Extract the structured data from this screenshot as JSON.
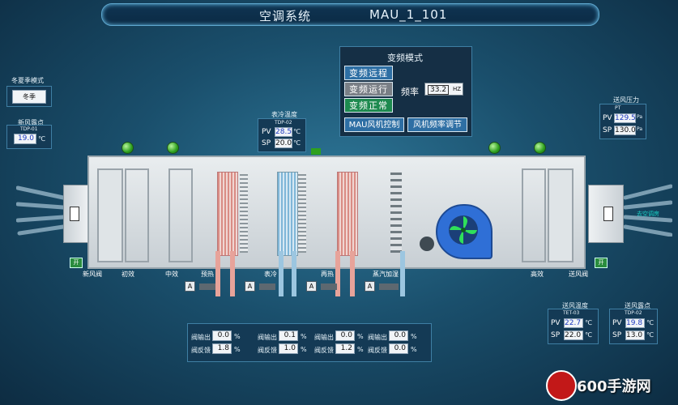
{
  "title": {
    "left": "空调系统",
    "right": "MAU_1_101"
  },
  "season": {
    "label": "冬夏季模式",
    "value": "冬季"
  },
  "fresh_dew": {
    "label": "新风露点",
    "tag": "TDP-01",
    "value": "19.0",
    "unit": "℃"
  },
  "surface_cool": {
    "label": "表冷温度",
    "tag": "TDP-02",
    "pv_label": "PV",
    "pv": "28.5",
    "sp_label": "SP",
    "sp": "20.0",
    "unit": "℃"
  },
  "vfd": {
    "title": "变频模式",
    "buttons": [
      "变频远程",
      "变频运行",
      "变频正常"
    ],
    "freq_label": "频率",
    "freq_value": "33.2",
    "freq_unit": "HZ",
    "ctrl_buttons": [
      "MAU风机控制",
      "风机频率调节"
    ]
  },
  "supply_pressure": {
    "label": "送风压力",
    "tag": "PT",
    "pv_label": "PV",
    "pv": "129.5",
    "sp_label": "SP",
    "sp": "130.0",
    "unit": "Pa"
  },
  "supply_temp": {
    "label": "送风温度",
    "tag": "TET-03",
    "pv_label": "PV",
    "pv": "22.7",
    "sp_label": "SP",
    "sp": "22.0",
    "unit": "℃"
  },
  "supply_dew": {
    "label": "送风露点",
    "tag": "TDP-02",
    "pv_label": "PV",
    "pv": "19.8",
    "sp_label": "SP",
    "sp": "13.0",
    "unit": "℃"
  },
  "sections": [
    "新风阀",
    "初效",
    "中效",
    "预热",
    "表冷",
    "再热",
    "蒸汽加湿",
    "高效",
    "送风阀"
  ],
  "outlet_label": "去空调房",
  "kai_label": "开",
  "valve_a": "A",
  "valves": [
    {
      "out_label": "阀输出",
      "out": "0.0",
      "fb_label": "阀反馈",
      "fb": "1.8",
      "unit": "%"
    },
    {
      "out_label": "阀输出",
      "out": "0.1",
      "fb_label": "阀反馈",
      "fb": "1.0",
      "unit": "%"
    },
    {
      "out_label": "阀输出",
      "out": "0.0",
      "fb_label": "阀反馈",
      "fb": "1.2",
      "unit": "%"
    },
    {
      "out_label": "阀输出",
      "out": "0.0",
      "fb_label": "阀反馈",
      "fb": "0.0",
      "unit": "%"
    }
  ],
  "watermark": "600手游网",
  "colors": {
    "accent_green": "#1d8a4f",
    "heating_red": "#d98c84",
    "cooling_blue": "#7fb6d8",
    "fan_blue": "#2f6fd6"
  }
}
